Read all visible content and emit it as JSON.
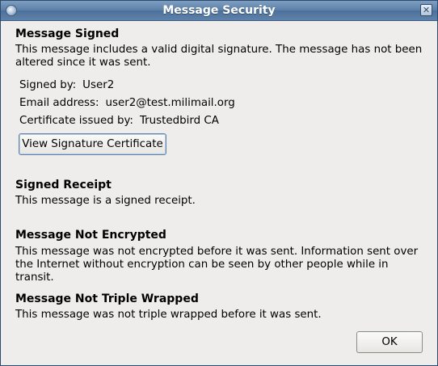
{
  "window": {
    "title": "Message Security",
    "close_symbol": "✕"
  },
  "signed": {
    "heading": "Message Signed",
    "description_line1": "This message includes a valid digital signature. The message has not been",
    "description_line2": "altered since it was sent.",
    "signed_by_label": "Signed by:",
    "signed_by_value": "User2",
    "email_label": "Email address:",
    "email_value": "user2@test.milimail.org",
    "issuer_label": "Certificate issued by:",
    "issuer_value": "Trustedbird CA",
    "view_cert_label": "View Signature Certificate"
  },
  "receipt": {
    "heading": "Signed Receipt",
    "description": "This message is a signed receipt."
  },
  "encryption": {
    "heading": "Message Not Encrypted",
    "description_line1": "This message was not encrypted before it was sent. Information sent over",
    "description_line2": "the Internet without encryption can be seen by other people while in transit."
  },
  "triple_wrap": {
    "heading": "Message Not Triple Wrapped",
    "description": "This message was not triple wrapped before it was sent."
  },
  "footer": {
    "ok_label": "OK"
  },
  "icons": {
    "app": "app-icon",
    "close": "close-icon"
  }
}
